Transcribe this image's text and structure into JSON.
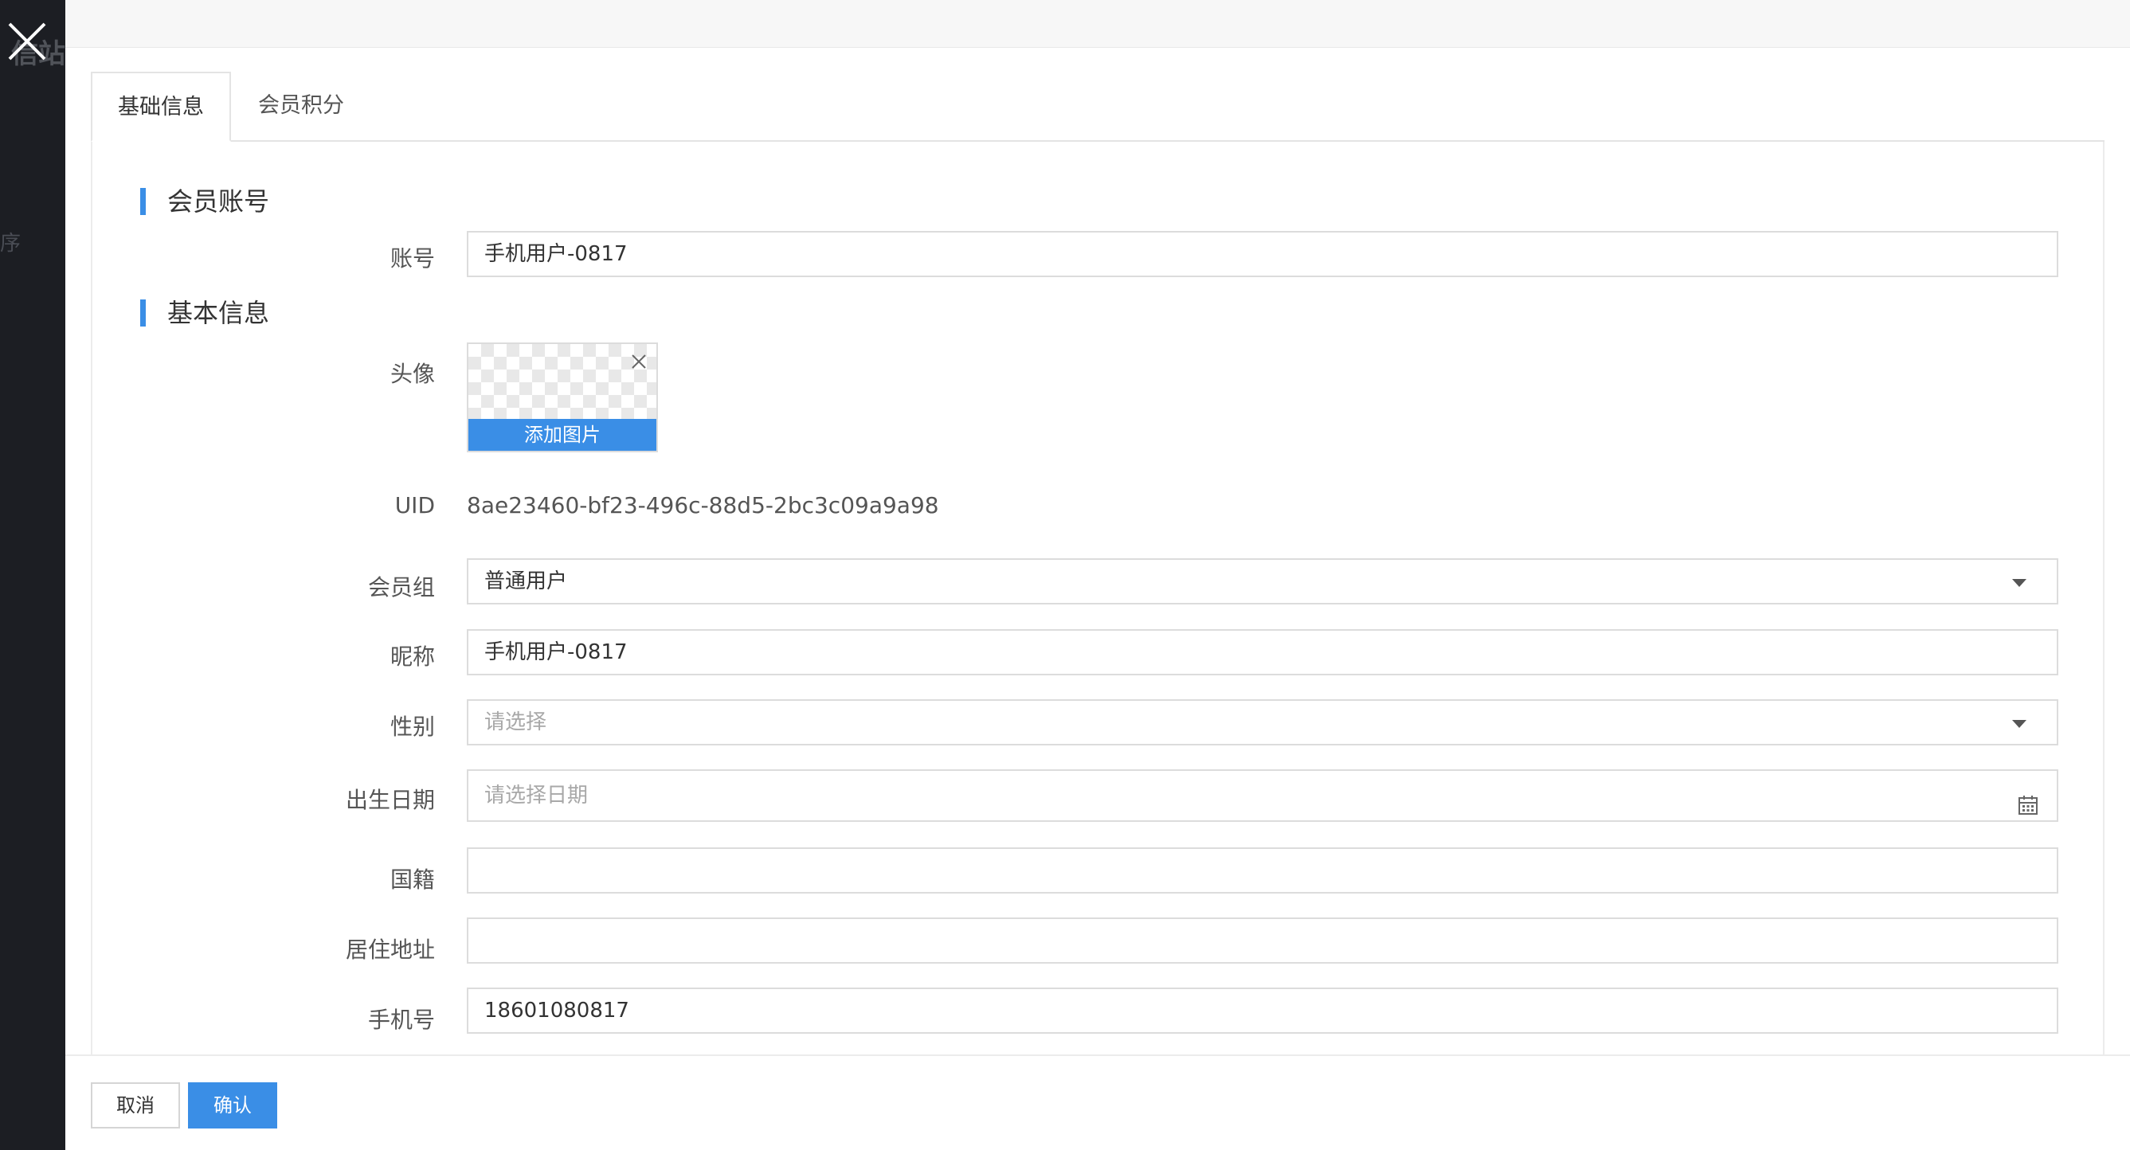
{
  "backdrop": {
    "partial_text_top": "信站",
    "partial_text_left": "序"
  },
  "tabs": [
    {
      "label": "基础信息",
      "active": true
    },
    {
      "label": "会员积分",
      "active": false
    }
  ],
  "sections": {
    "account": "会员账号",
    "basic": "基本信息"
  },
  "fields": {
    "account": {
      "label": "账号",
      "value": "手机用户-0817"
    },
    "avatar": {
      "label": "头像",
      "add_label": "添加图片"
    },
    "uid": {
      "label": "UID",
      "value": "8ae23460-bf23-496c-88d5-2bc3c09a9a98"
    },
    "member_group": {
      "label": "会员组",
      "value": "普通用户"
    },
    "nickname": {
      "label": "昵称",
      "value": "手机用户-0817"
    },
    "gender": {
      "label": "性别",
      "placeholder": "请选择"
    },
    "birthday": {
      "label": "出生日期",
      "placeholder": "请选择日期"
    },
    "nationality": {
      "label": "国籍",
      "value": ""
    },
    "address": {
      "label": "居住地址",
      "value": ""
    },
    "phone": {
      "label": "手机号",
      "value": "18601080817"
    }
  },
  "footer": {
    "cancel_label": "取消",
    "confirm_label": "确认"
  },
  "colors": {
    "accent": "#3a8ee6",
    "backdrop": "#1c1e23"
  },
  "icons": [
    "close-icon",
    "remove-icon",
    "chevron-down-icon",
    "calendar-icon"
  ]
}
